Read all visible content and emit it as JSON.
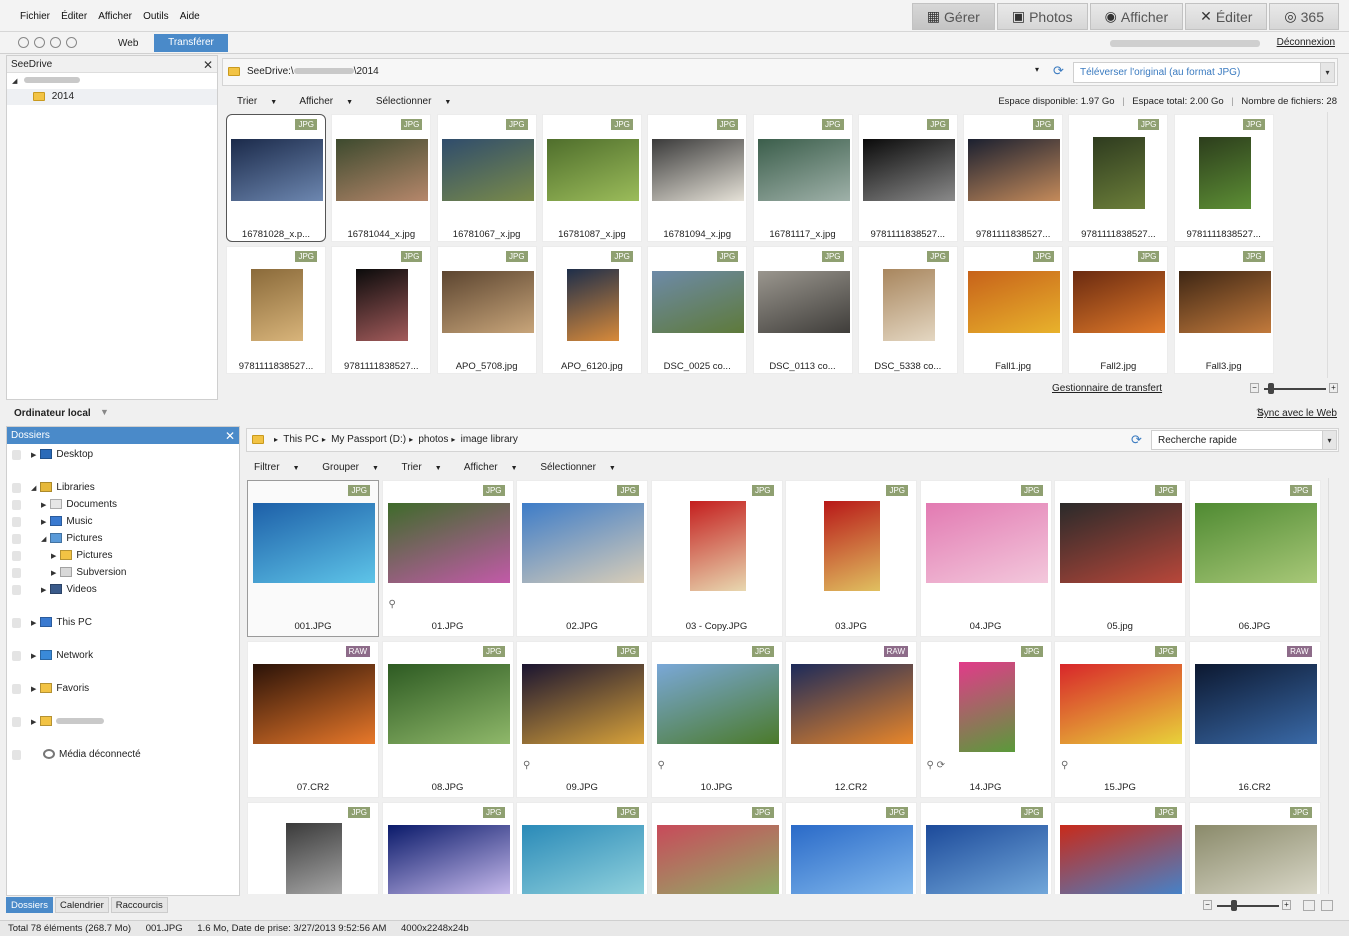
{
  "menu": [
    "Fichier",
    "Éditer",
    "Afficher",
    "Outils",
    "Aide"
  ],
  "modes": [
    {
      "label": "Gérer",
      "icon": "grid-icon"
    },
    {
      "label": "Photos",
      "icon": "photos-icon"
    },
    {
      "label": "Afficher",
      "icon": "eye-icon"
    },
    {
      "label": "Éditer",
      "icon": "tools-icon"
    },
    {
      "label": "365",
      "icon": "acdsee-365-icon"
    }
  ],
  "nav": {
    "web": "Web",
    "transfer": "Transférer",
    "disconnect": "Déconnexion"
  },
  "seedrive": {
    "title": "SeeDrive",
    "folder": "2014",
    "path": "SeeDrive:\\",
    "path_tail": "\\2014",
    "upload_option": "Téléverser l'original (au format JPG)",
    "toolbar": [
      "Trier",
      "Afficher",
      "Sélectionner"
    ],
    "space_available": "Espace disponible: 1.97 Go",
    "space_total": "Espace total: 2.00 Go",
    "file_count": "Nombre de fichiers: 28",
    "transfer_manager": "Gestionnaire de transfert",
    "thumbs": [
      {
        "name": "16781028_x.p...",
        "badge": "JPG",
        "c1": "#1b2a4a",
        "c2": "#6d87b0"
      },
      {
        "name": "16781044_x.jpg",
        "badge": "JPG",
        "c1": "#3d4a2e",
        "c2": "#b6876b"
      },
      {
        "name": "16781067_x.jpg",
        "badge": "JPG",
        "c1": "#2f4c6c",
        "c2": "#7a8b4a"
      },
      {
        "name": "16781087_x.jpg",
        "badge": "JPG",
        "c1": "#4f6e2c",
        "c2": "#9bbc5a"
      },
      {
        "name": "16781094_x.jpg",
        "badge": "JPG",
        "c1": "#3a3a3a",
        "c2": "#e6e2d8"
      },
      {
        "name": "16781117_x.jpg",
        "badge": "JPG",
        "c1": "#3b5e4b",
        "c2": "#9fb1a9"
      },
      {
        "name": "9781111838527...",
        "badge": "JPG",
        "c1": "#0a0a0a",
        "c2": "#8a8a8a"
      },
      {
        "name": "9781111838527...",
        "badge": "JPG",
        "c1": "#1b2030",
        "c2": "#c48a5a"
      },
      {
        "name": "9781111838527...",
        "badge": "JPG",
        "c1": "#2e3b1f",
        "c2": "#6c7f3a"
      },
      {
        "name": "9781111838527...",
        "badge": "JPG",
        "c1": "#2c3d1c",
        "c2": "#5d8f35"
      },
      {
        "name": "9781111838527...",
        "badge": "JPG",
        "c1": "#8a6a3a",
        "c2": "#d8b47a"
      },
      {
        "name": "9781111838527...",
        "badge": "JPG",
        "c1": "#0b0b0b",
        "c2": "#a35b5b"
      },
      {
        "name": "APO_5708.jpg",
        "badge": "JPG",
        "c1": "#5c4530",
        "c2": "#c8a57a"
      },
      {
        "name": "APO_6120.jpg",
        "badge": "JPG",
        "c1": "#1e2e4a",
        "c2": "#d88a3a"
      },
      {
        "name": "DSC_0025 co...",
        "badge": "JPG",
        "c1": "#6d8aa8",
        "c2": "#5e7a3a"
      },
      {
        "name": "DSC_0113 co...",
        "badge": "JPG",
        "c1": "#9a968e",
        "c2": "#3f3d3a"
      },
      {
        "name": "DSC_5338 co...",
        "badge": "JPG",
        "c1": "#a8865e",
        "c2": "#e4d7c2"
      },
      {
        "name": "Fall1.jpg",
        "badge": "JPG",
        "c1": "#c7621a",
        "c2": "#e8b22c"
      },
      {
        "name": "Fall2.jpg",
        "badge": "JPG",
        "c1": "#6a2a10",
        "c2": "#e07a2a"
      },
      {
        "name": "Fall3.jpg",
        "badge": "JPG",
        "c1": "#3e2614",
        "c2": "#c27a3c"
      }
    ]
  },
  "local": {
    "title": "Ordinateur local",
    "sync": "Sync avec le Web",
    "folders_title": "Dossiers",
    "tree": [
      {
        "label": "Desktop",
        "icon": "desktop-icon",
        "indent": 0,
        "gap": 0
      },
      {
        "label": "Libraries",
        "icon": "libraries-icon",
        "indent": 0,
        "gap": 16
      },
      {
        "label": "Documents",
        "icon": "documents-icon",
        "indent": 1,
        "gap": 0
      },
      {
        "label": "Music",
        "icon": "music-icon",
        "indent": 1,
        "gap": 0
      },
      {
        "label": "Pictures",
        "icon": "pictures-icon",
        "indent": 1,
        "gap": 0
      },
      {
        "label": "Pictures",
        "icon": "folder-icon",
        "indent": 2,
        "gap": 0
      },
      {
        "label": "Subversion",
        "icon": "subversion-icon",
        "indent": 2,
        "gap": 0
      },
      {
        "label": "Videos",
        "icon": "videos-icon",
        "indent": 1,
        "gap": 0
      },
      {
        "label": "This PC",
        "icon": "pc-icon",
        "indent": 0,
        "gap": 16
      },
      {
        "label": "Network",
        "icon": "network-icon",
        "indent": 0,
        "gap": 16
      },
      {
        "label": "Favoris",
        "icon": "favorites-icon",
        "indent": 0,
        "gap": 16
      },
      {
        "label": "",
        "icon": "user-folder-icon",
        "indent": 0,
        "gap": 16
      },
      {
        "label": "Média déconnecté",
        "icon": "disconnected-media-icon",
        "indent": 0,
        "gap": 16
      }
    ],
    "tabs": [
      "Dossiers",
      "Calendrier",
      "Raccourcis"
    ],
    "breadcrumb": [
      "This PC",
      "My Passport (D:)",
      "photos",
      "image library"
    ],
    "search_placeholder": "Recherche rapide",
    "toolbar": [
      "Filtrer",
      "Grouper",
      "Trier",
      "Afficher",
      "Sélectionner"
    ],
    "thumbs": [
      {
        "name": "001.JPG",
        "badge": "JPG",
        "c1": "#1d5fa8",
        "c2": "#5ec4e8",
        "pin": ""
      },
      {
        "name": "01.JPG",
        "badge": "JPG",
        "c1": "#3e6b2a",
        "c2": "#c25aa8",
        "pin": "⚲"
      },
      {
        "name": "02.JPG",
        "badge": "JPG",
        "c1": "#3d7cc8",
        "c2": "#d8cdb8",
        "pin": ""
      },
      {
        "name": "03 - Copy.JPG",
        "badge": "JPG",
        "c1": "#c41e1e",
        "c2": "#e8d8b0",
        "pin": ""
      },
      {
        "name": "03.JPG",
        "badge": "JPG",
        "c1": "#b81818",
        "c2": "#e0c060",
        "pin": ""
      },
      {
        "name": "04.JPG",
        "badge": "JPG",
        "c1": "#e27ab2",
        "c2": "#f3c8dc",
        "pin": ""
      },
      {
        "name": "05.jpg",
        "badge": "JPG",
        "c1": "#2a2a2a",
        "c2": "#b8473a",
        "pin": ""
      },
      {
        "name": "06.JPG",
        "badge": "JPG",
        "c1": "#4f8a32",
        "c2": "#a8c878",
        "pin": ""
      },
      {
        "name": "07.CR2",
        "badge": "RAW",
        "c1": "#2a1208",
        "c2": "#e8782a",
        "pin": ""
      },
      {
        "name": "08.JPG",
        "badge": "JPG",
        "c1": "#2d5a22",
        "c2": "#8fb86a",
        "pin": ""
      },
      {
        "name": "09.JPG",
        "badge": "JPG",
        "c1": "#1a1430",
        "c2": "#d8a23a",
        "pin": "⚲"
      },
      {
        "name": "10.JPG",
        "badge": "JPG",
        "c1": "#7aa8d8",
        "c2": "#4b7a2a",
        "pin": "⚲"
      },
      {
        "name": "12.CR2",
        "badge": "RAW",
        "c1": "#1c2a5a",
        "c2": "#e8862a",
        "pin": ""
      },
      {
        "name": "14.JPG",
        "badge": "JPG",
        "c1": "#e23a8a",
        "c2": "#5a9a3a",
        "pin": "⚲ ⟳"
      },
      {
        "name": "15.JPG",
        "badge": "JPG",
        "c1": "#d8262a",
        "c2": "#e8d23a",
        "pin": "⚲"
      },
      {
        "name": "16.CR2",
        "badge": "RAW",
        "c1": "#0c1830",
        "c2": "#3a6aa8",
        "pin": ""
      },
      {
        "name": "",
        "badge": "JPG",
        "c1": "#3a3a3a",
        "c2": "#bcbcbc",
        "pin": ""
      },
      {
        "name": "",
        "badge": "JPG",
        "c1": "#0a1a6a",
        "c2": "#d8c8f8",
        "pin": ""
      },
      {
        "name": "",
        "badge": "JPG",
        "c1": "#2a8ab8",
        "c2": "#9ad8e0",
        "pin": ""
      },
      {
        "name": "",
        "badge": "JPG",
        "c1": "#c84a5a",
        "c2": "#8ab868",
        "pin": ""
      },
      {
        "name": "",
        "badge": "JPG",
        "c1": "#2a6ac8",
        "c2": "#8ac0f0",
        "pin": ""
      },
      {
        "name": "",
        "badge": "JPG",
        "c1": "#1c4a9a",
        "c2": "#7ab0e0",
        "pin": ""
      },
      {
        "name": "",
        "badge": "JPG",
        "c1": "#c82a1a",
        "c2": "#3a8ad8",
        "pin": ""
      },
      {
        "name": "",
        "badge": "JPG",
        "c1": "#8a8a6a",
        "c2": "#e0ded0",
        "pin": ""
      }
    ]
  },
  "status": {
    "total": "Total 78 éléments (268.7 Mo)",
    "file": "001.JPG",
    "info": "1.6 Mo, Date de prise: 3/27/2013 9:52:56 AM",
    "dims": "4000x2248x24b"
  },
  "colors": {
    "accent": "#4a8ac9",
    "badge_jpg": "#8fa071",
    "badge_raw": "#8d6b89"
  }
}
